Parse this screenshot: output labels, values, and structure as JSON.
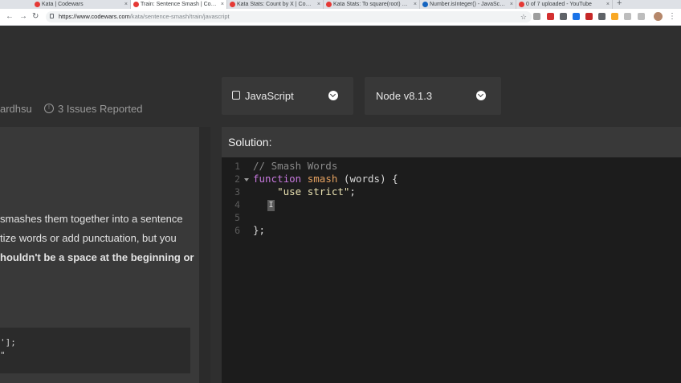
{
  "browser": {
    "tabs": [
      {
        "label": "Kata | Codewars",
        "active": false,
        "favicon_color": "#e53935"
      },
      {
        "label": "Train: Sentence Smash | Codewars",
        "active": true,
        "favicon_color": "#e53935"
      },
      {
        "label": "Kata Stats: Count by X | Codewars",
        "active": false,
        "favicon_color": "#e53935"
      },
      {
        "label": "Kata Stats: To square(root) or no",
        "active": false,
        "favicon_color": "#e53935"
      },
      {
        "label": "Number.isInteger() - JavaScript",
        "active": false,
        "favicon_color": "#1565c0"
      },
      {
        "label": "0 of 7 uploaded - YouTube",
        "active": false,
        "favicon_color": "#e53935"
      }
    ],
    "close_glyph": "×",
    "new_tab_glyph": "+",
    "back_glyph": "←",
    "forward_glyph": "→",
    "reload_glyph": "↻",
    "url_host": "https://www.codewars.com",
    "url_path": "/kata/sentence-smash/train/javascript",
    "star_glyph": "☆",
    "menu_glyph": "⋮",
    "extension_colors": [
      "#9e9e9e",
      "#d32f2f",
      "#5f6368",
      "#1a73e8",
      "#c62828",
      "#5f6368",
      "#f9a825",
      "#bdbdbd",
      "#bdbdbd",
      "#5f6368"
    ]
  },
  "kata": {
    "author_partial": "ardhsu",
    "issues_icon": "!",
    "issues_label": "3 Issues Reported",
    "language_label": "JavaScript",
    "version_label": "Node v8.1.3",
    "description_lines": [
      {
        "text": "smashes them together into a sentence",
        "bold": false
      },
      {
        "text": "tize words or add punctuation, but you",
        "bold": false
      },
      {
        "text": "houldn't be a space at the beginning or",
        "bold": true
      }
    ],
    "example_lines": [
      "'];",
      "\""
    ]
  },
  "solution": {
    "title": "Solution:",
    "line_numbers": [
      "1",
      "2",
      "3",
      "4",
      "5",
      "6"
    ],
    "line1_comment": "// Smash Words",
    "line2_keyword": "function",
    "line2_name": "smash",
    "line2_rest": "(words) {",
    "line3_string": "\"use strict\"",
    "line3_tail": ";",
    "cursor_glyph": "I",
    "line6_text": "};"
  }
}
